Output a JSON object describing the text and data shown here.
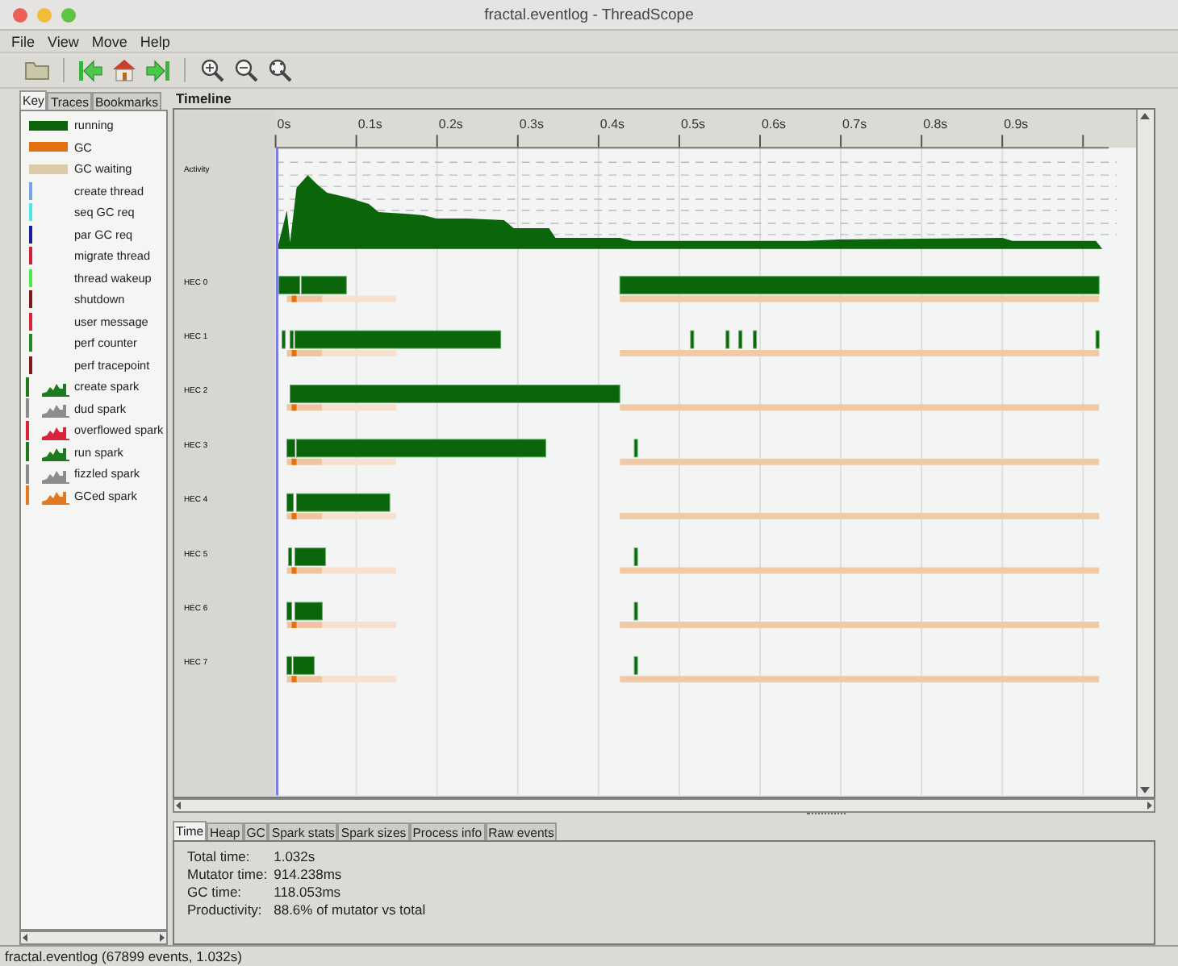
{
  "window": {
    "title": "fractal.eventlog - ThreadScope"
  },
  "menu": [
    "File",
    "View",
    "Move",
    "Help"
  ],
  "sidebar": {
    "tabs": [
      {
        "label": "Key",
        "selected": true
      },
      {
        "label": "Traces",
        "selected": false
      },
      {
        "label": "Bookmarks",
        "selected": false
      }
    ],
    "key": [
      {
        "label": "running",
        "kind": "bar",
        "color": "#0b650b"
      },
      {
        "label": "GC",
        "kind": "bar",
        "color": "#e2720f"
      },
      {
        "label": "GC waiting",
        "kind": "bar",
        "color": "#dccbaa"
      },
      {
        "label": "create thread",
        "kind": "line",
        "color": "#76a3ea"
      },
      {
        "label": "seq GC req",
        "kind": "line",
        "color": "#4ce6e6"
      },
      {
        "label": "par GC req",
        "kind": "line",
        "color": "#1c1ca0"
      },
      {
        "label": "migrate thread",
        "kind": "line",
        "color": "#cc2233"
      },
      {
        "label": "thread wakeup",
        "kind": "line",
        "color": "#44ee44"
      },
      {
        "label": "shutdown",
        "kind": "line",
        "color": "#801822"
      },
      {
        "label": "user message",
        "kind": "line",
        "color": "#d8243a"
      },
      {
        "label": "perf counter",
        "kind": "line",
        "color": "#238a23"
      },
      {
        "label": "perf tracepoint",
        "kind": "line",
        "color": "#801822"
      },
      {
        "label": "create spark",
        "kind": "spark",
        "color": "#1f7a1f"
      },
      {
        "label": "dud spark",
        "kind": "spark",
        "color": "#8c8c8c"
      },
      {
        "label": "overflowed spark",
        "kind": "spark",
        "color": "#d8243a"
      },
      {
        "label": "run spark",
        "kind": "spark",
        "color": "#1f7a1f"
      },
      {
        "label": "fizzled spark",
        "kind": "spark",
        "color": "#8c8c8c"
      },
      {
        "label": "GCed spark",
        "kind": "spark",
        "color": "#e2781f"
      }
    ]
  },
  "timeline": {
    "title": "Timeline",
    "ticks": [
      "0s",
      "0.1s",
      "0.2s",
      "0.3s",
      "0.4s",
      "0.5s",
      "0.6s",
      "0.7s",
      "0.8s",
      "0.9s"
    ],
    "activity_label": "Activity",
    "traces": [
      "HEC 0",
      "HEC 1",
      "HEC 2",
      "HEC 3",
      "HEC 4",
      "HEC 5",
      "HEC 6",
      "HEC 7"
    ]
  },
  "details": {
    "tabs": [
      {
        "label": "Time",
        "selected": true
      },
      {
        "label": "Heap",
        "selected": false
      },
      {
        "label": "GC",
        "selected": false
      },
      {
        "label": "Spark stats",
        "selected": false
      },
      {
        "label": "Spark sizes",
        "selected": false
      },
      {
        "label": "Process info",
        "selected": false
      },
      {
        "label": "Raw events",
        "selected": false
      }
    ],
    "stats": [
      {
        "label": "Total time:",
        "value": "1.032s"
      },
      {
        "label": "Mutator time:",
        "value": "914.238ms"
      },
      {
        "label": "GC time:",
        "value": "118.053ms"
      },
      {
        "label": "Productivity:",
        "value": "88.6% of mutator vs total"
      }
    ]
  },
  "status_bar": "fractal.eventlog (67899 events, 1.032s)"
}
